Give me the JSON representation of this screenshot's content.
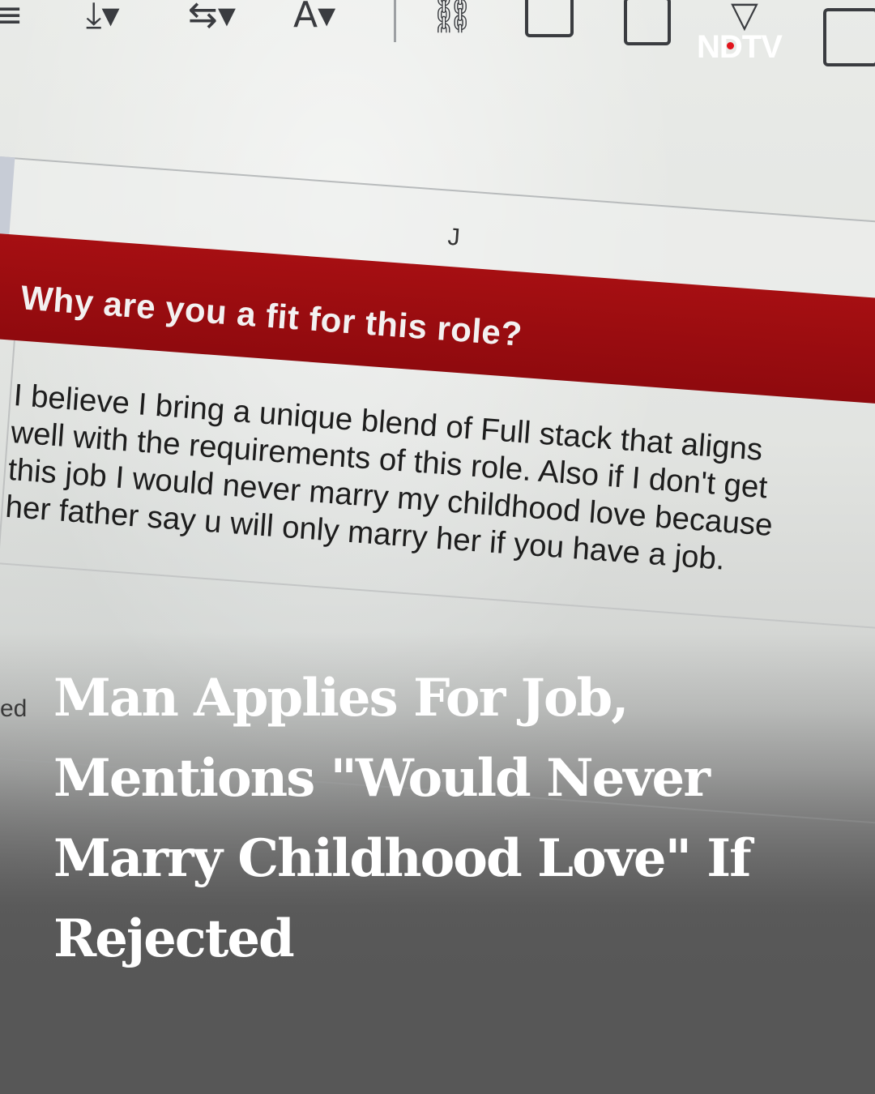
{
  "brand": {
    "logo_text": "NDTV",
    "accent": "#e1141c"
  },
  "toolbar": {
    "icons": [
      "menu-icon",
      "text-rotate-icon",
      "text-direction-icon",
      "text-color-icon",
      "link-icon",
      "add-comment-icon",
      "insert-chart-icon",
      "filter-icon",
      "calculator-icon"
    ]
  },
  "sheet": {
    "column_letter": "J",
    "header_color": "#a60f12",
    "question": "Why are you a fit for this role?",
    "answer_lines": [
      "I believe I bring a unique blend of Full stack that aligns",
      "well with the requirements of this role. Also if I don't get",
      "this job I would never marry my childhood love because",
      "her father say u will only marry her if you have a job."
    ],
    "side_fragment": "ed"
  },
  "headline": {
    "lines": [
      "Man Applies For Job,",
      "Mentions \"Would Never",
      "Marry Childhood Love\" If",
      "Rejected"
    ]
  }
}
